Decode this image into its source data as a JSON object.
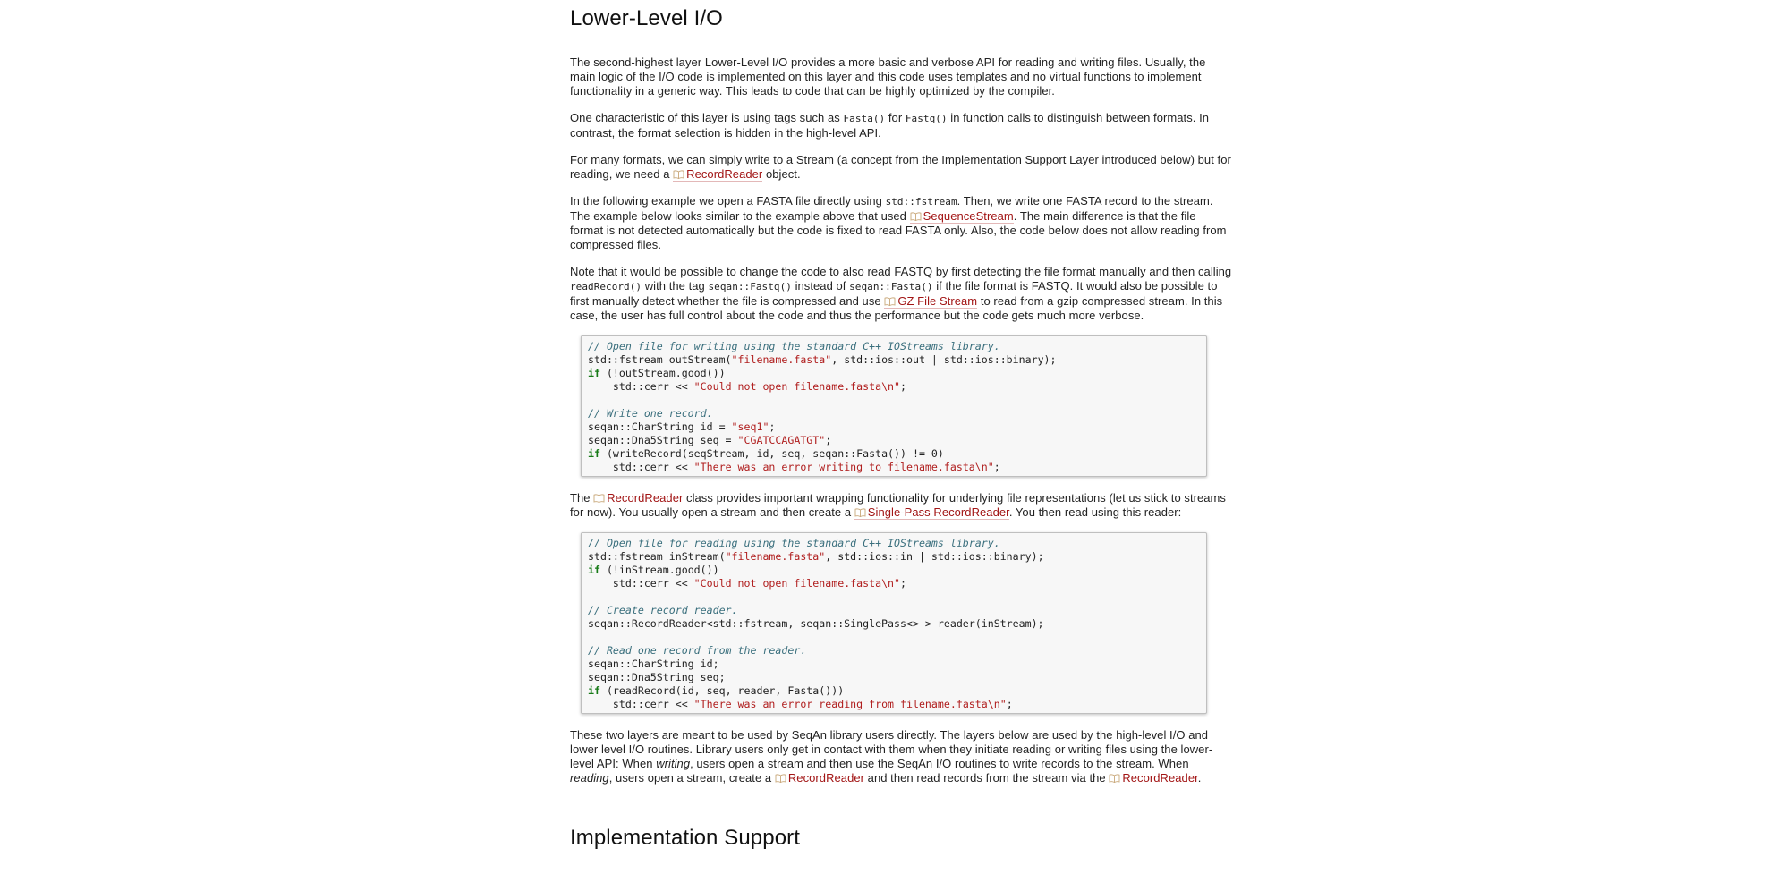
{
  "heading_lower_level": "Lower-Level I/O",
  "heading_impl_support": "Implementation Support",
  "icon": "book-icon",
  "colors": {
    "link": "#a21515",
    "code_comment": "#3a6f7d",
    "code_string": "#b01e1e",
    "code_keyword": "#177a17",
    "code_background": "#f7f7f7"
  },
  "p1": "The second-highest layer Lower-Level I/O provides a more basic and verbose API for reading and writing files. Usually, the main logic of the I/O code is implemented on this layer and this code uses templates and no virtual functions to implement functionality in a generic way. This leads to code that can be highly optimized by the compiler.",
  "p2": {
    "t1": "One characteristic of this layer is using tags such as ",
    "c1": "Fasta()",
    "t2": " for ",
    "c2": "Fastq()",
    "t3": " in function calls to distinguish between formats. In contrast, the format selection is hidden in the high-level API."
  },
  "p3": {
    "t1": "For many formats, we can simply write to a Stream (a concept from the Implementation Support Layer introduced below) but for reading, we need a ",
    "link1": "RecordReader",
    "t2": " object."
  },
  "p4": {
    "t1": "In the following example we open a FASTA file directly using ",
    "c1": "std::fstream",
    "t2": ". Then, we write one FASTA record to the stream. The example below looks similar to the example above that used ",
    "link1": "SequenceStream",
    "t3": ". The main difference is that the file format is not detected automatically but the code is fixed to read FASTA only. Also, the code below does not allow reading from compressed files."
  },
  "p5": {
    "t1": "Note that it would be possible to change the code to also read FASTQ by first detecting the file format manually and then calling ",
    "c1": "readRecord()",
    "t2": " with the tag ",
    "c2": "seqan::Fastq()",
    "t3": " instead of ",
    "c3": "seqan::Fasta()",
    "t4": " if the file format is FASTQ. It would also be possible to first manually detect whether the file is compressed and use ",
    "link1": "GZ File Stream",
    "t5": " to read from a gzip compressed stream. In this case, the user has full control about the code and thus the performance but the code gets much more verbose."
  },
  "code1": {
    "l1": "// Open file for writing using the standard C++ IOStreams library.",
    "l2a": "std::fstream outStream(",
    "l2s": "\"filename.fasta\"",
    "l2b": ", std::ios::out | std::ios::binary);",
    "l3k": "if",
    "l3b": " (!outStream.good())",
    "l4a": "    std::cerr << ",
    "l4s": "\"Could not open filename.fasta\\n\"",
    "l4b": ";",
    "l6": "// Write one record.",
    "l7a": "seqan::CharString id = ",
    "l7s": "\"seq1\"",
    "l7b": ";",
    "l8a": "seqan::Dna5String seq = ",
    "l8s": "\"CGATCCAGATGT\"",
    "l8b": ";",
    "l9k": "if",
    "l9b": " (writeRecord(seqStream, id, seq, seqan::Fasta()) != 0)",
    "l10a": "    std::cerr << ",
    "l10s": "\"There was an error writing to filename.fasta\\n\"",
    "l10b": ";"
  },
  "p6": {
    "t1": "The ",
    "link1": "RecordReader",
    "t2": " class provides important wrapping functionality for underlying file representations (let us stick to streams for now). You usually open a stream and then create a ",
    "link2": "Single-Pass RecordReader",
    "t3": ". You then read using this reader:"
  },
  "code2": {
    "l1": "// Open file for reading using the standard C++ IOStreams library.",
    "l2a": "std::fstream inStream(",
    "l2s": "\"filename.fasta\"",
    "l2b": ", std::ios::in | std::ios::binary);",
    "l3k": "if",
    "l3b": " (!inStream.good())",
    "l4a": "    std::cerr << ",
    "l4s": "\"Could not open filename.fasta\\n\"",
    "l4b": ";",
    "l6": "// Create record reader.",
    "l7": "seqan::RecordReader<std::fstream, seqan::SinglePass<> > reader(inStream);",
    "l9": "// Read one record from the reader.",
    "l10": "seqan::CharString id;",
    "l11": "seqan::Dna5String seq;",
    "l12k": "if",
    "l12b": " (readRecord(id, seq, reader, Fasta()))",
    "l13a": "    std::cerr << ",
    "l13s": "\"There was an error reading from filename.fasta\\n\"",
    "l13b": ";"
  },
  "p7": {
    "t1": "These two layers are meant to be used by SeqAn library users directly. The layers below are used by the high-level I/O and lower level I/O routines. Library users only get in contact with them when they initiate reading or writing files using the lower-level API: When ",
    "e1": "writing",
    "t2": ", users open a stream and then use the SeqAn I/O routines to write records to the stream. When ",
    "e2": "reading",
    "t3": ", users open a stream, create a ",
    "link1": "RecordReader",
    "t4": " and then read records from the stream via the ",
    "link2": "RecordReader",
    "t5": "."
  }
}
